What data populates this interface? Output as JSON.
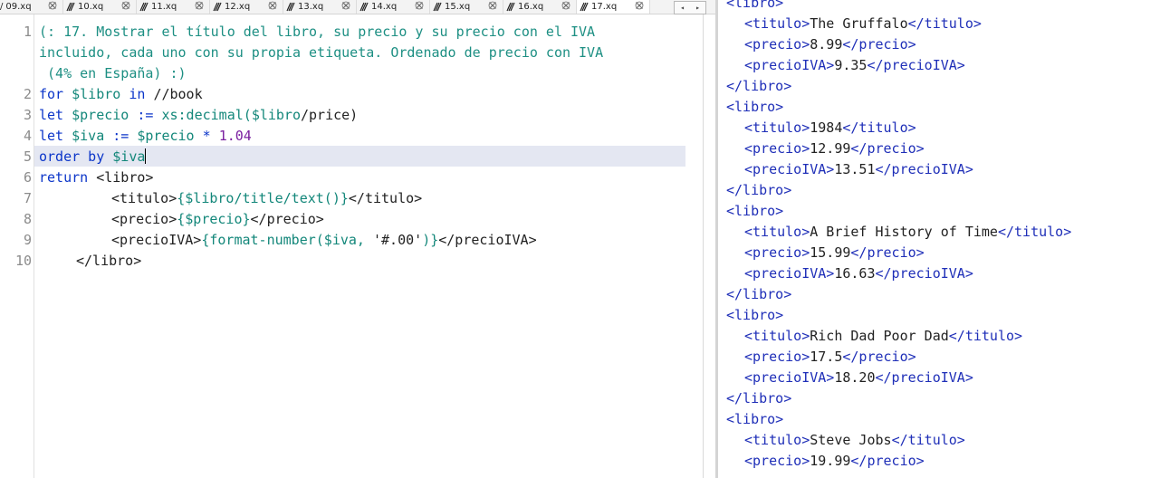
{
  "tabs": [
    {
      "label": "09.xq"
    },
    {
      "label": "10.xq"
    },
    {
      "label": "11.xq"
    },
    {
      "label": "12.xq"
    },
    {
      "label": "13.xq"
    },
    {
      "label": "14.xq"
    },
    {
      "label": "15.xq"
    },
    {
      "label": "16.xq"
    },
    {
      "label": "17.xq",
      "active": true
    }
  ],
  "tab_nav": {
    "left": "◂",
    "right": "▸"
  },
  "editor": {
    "line_numbers": [
      "1",
      "2",
      "3",
      "4",
      "5",
      "6",
      "7",
      "8",
      "9",
      "10"
    ],
    "current_line": "5",
    "code": {
      "l1a": "(: 17. Mostrar el título del libro, su precio y su precio con el IVA",
      "l1b": "incluido, cada uno con su propia etiqueta. Ordenado de precio con IVA",
      "l1c": " (4% en España) :)",
      "l2_kw": "for ",
      "l2_var": "$libro",
      "l2_kw2": " in ",
      "l2_txt": "//book",
      "l3_kw": "let ",
      "l3_var": "$precio",
      "l3_txt": " := ",
      "l3_fn": "xs:decimal(",
      "l3_var2": "$libro",
      "l3_txt2": "/price)",
      "l4_kw": "let ",
      "l4_var": "$iva",
      "l4_txt": " := ",
      "l4_var2": "$precio",
      "l4_txt2": " * ",
      "l4_num": "1.04",
      "l5_kw": "order by ",
      "l5_var": "$iva",
      "l6_kw": "return ",
      "l6_txt": "<libro>",
      "l7_txt": "<titulo>",
      "l7_expr": "{$libro/title/text()}",
      "l7_txt2": "</titulo>",
      "l8_txt": "<precio>",
      "l8_expr": "{$precio}",
      "l8_txt2": "</precio>",
      "l9_txt": "<precioIVA>",
      "l9_expr1": "{format-number($iva, ",
      "l9_str": "'#.00'",
      "l9_expr2": ")}",
      "l9_txt2": "</precioIVA>",
      "l10_txt": "</libro>"
    }
  },
  "results": {
    "lines": [
      {
        "o": "<libro>"
      },
      {
        "o": "<titulo>",
        "v": "The Gruffalo",
        "c": "</titulo>"
      },
      {
        "o": "<precio>",
        "v": "8.99",
        "c": "</precio>"
      },
      {
        "o": "<precioIVA>",
        "v": "9.35",
        "c": "</precioIVA>"
      },
      {
        "o": "</libro>"
      },
      {
        "o": "<libro>"
      },
      {
        "o": "<titulo>",
        "v": "1984",
        "c": "</titulo>"
      },
      {
        "o": "<precio>",
        "v": "12.99",
        "c": "</precio>"
      },
      {
        "o": "<precioIVA>",
        "v": "13.51",
        "c": "</precioIVA>"
      },
      {
        "o": "</libro>"
      },
      {
        "o": "<libro>"
      },
      {
        "o": "<titulo>",
        "v": "A Brief History of Time",
        "c": "</titulo>"
      },
      {
        "o": "<precio>",
        "v": "15.99",
        "c": "</precio>"
      },
      {
        "o": "<precioIVA>",
        "v": "16.63",
        "c": "</precioIVA>"
      },
      {
        "o": "</libro>"
      },
      {
        "o": "<libro>"
      },
      {
        "o": "<titulo>",
        "v": "Rich Dad Poor Dad",
        "c": "</titulo>"
      },
      {
        "o": "<precio>",
        "v": "17.5",
        "c": "</precio>"
      },
      {
        "o": "<precioIVA>",
        "v": "18.20",
        "c": "</precioIVA>"
      },
      {
        "o": "</libro>"
      },
      {
        "o": "<libro>"
      },
      {
        "o": "<titulo>",
        "v": "Steve Jobs",
        "c": "</titulo>"
      },
      {
        "o": "<precio>",
        "v": "19.99",
        "c": "</precio>"
      }
    ]
  },
  "colors": {
    "keyword": "#0b35c9",
    "variable": "#13877a",
    "comment": "#1d8f83",
    "number": "#7a1fa0",
    "tag": "#1f2fb8",
    "current_line": "#e4e7f2"
  }
}
